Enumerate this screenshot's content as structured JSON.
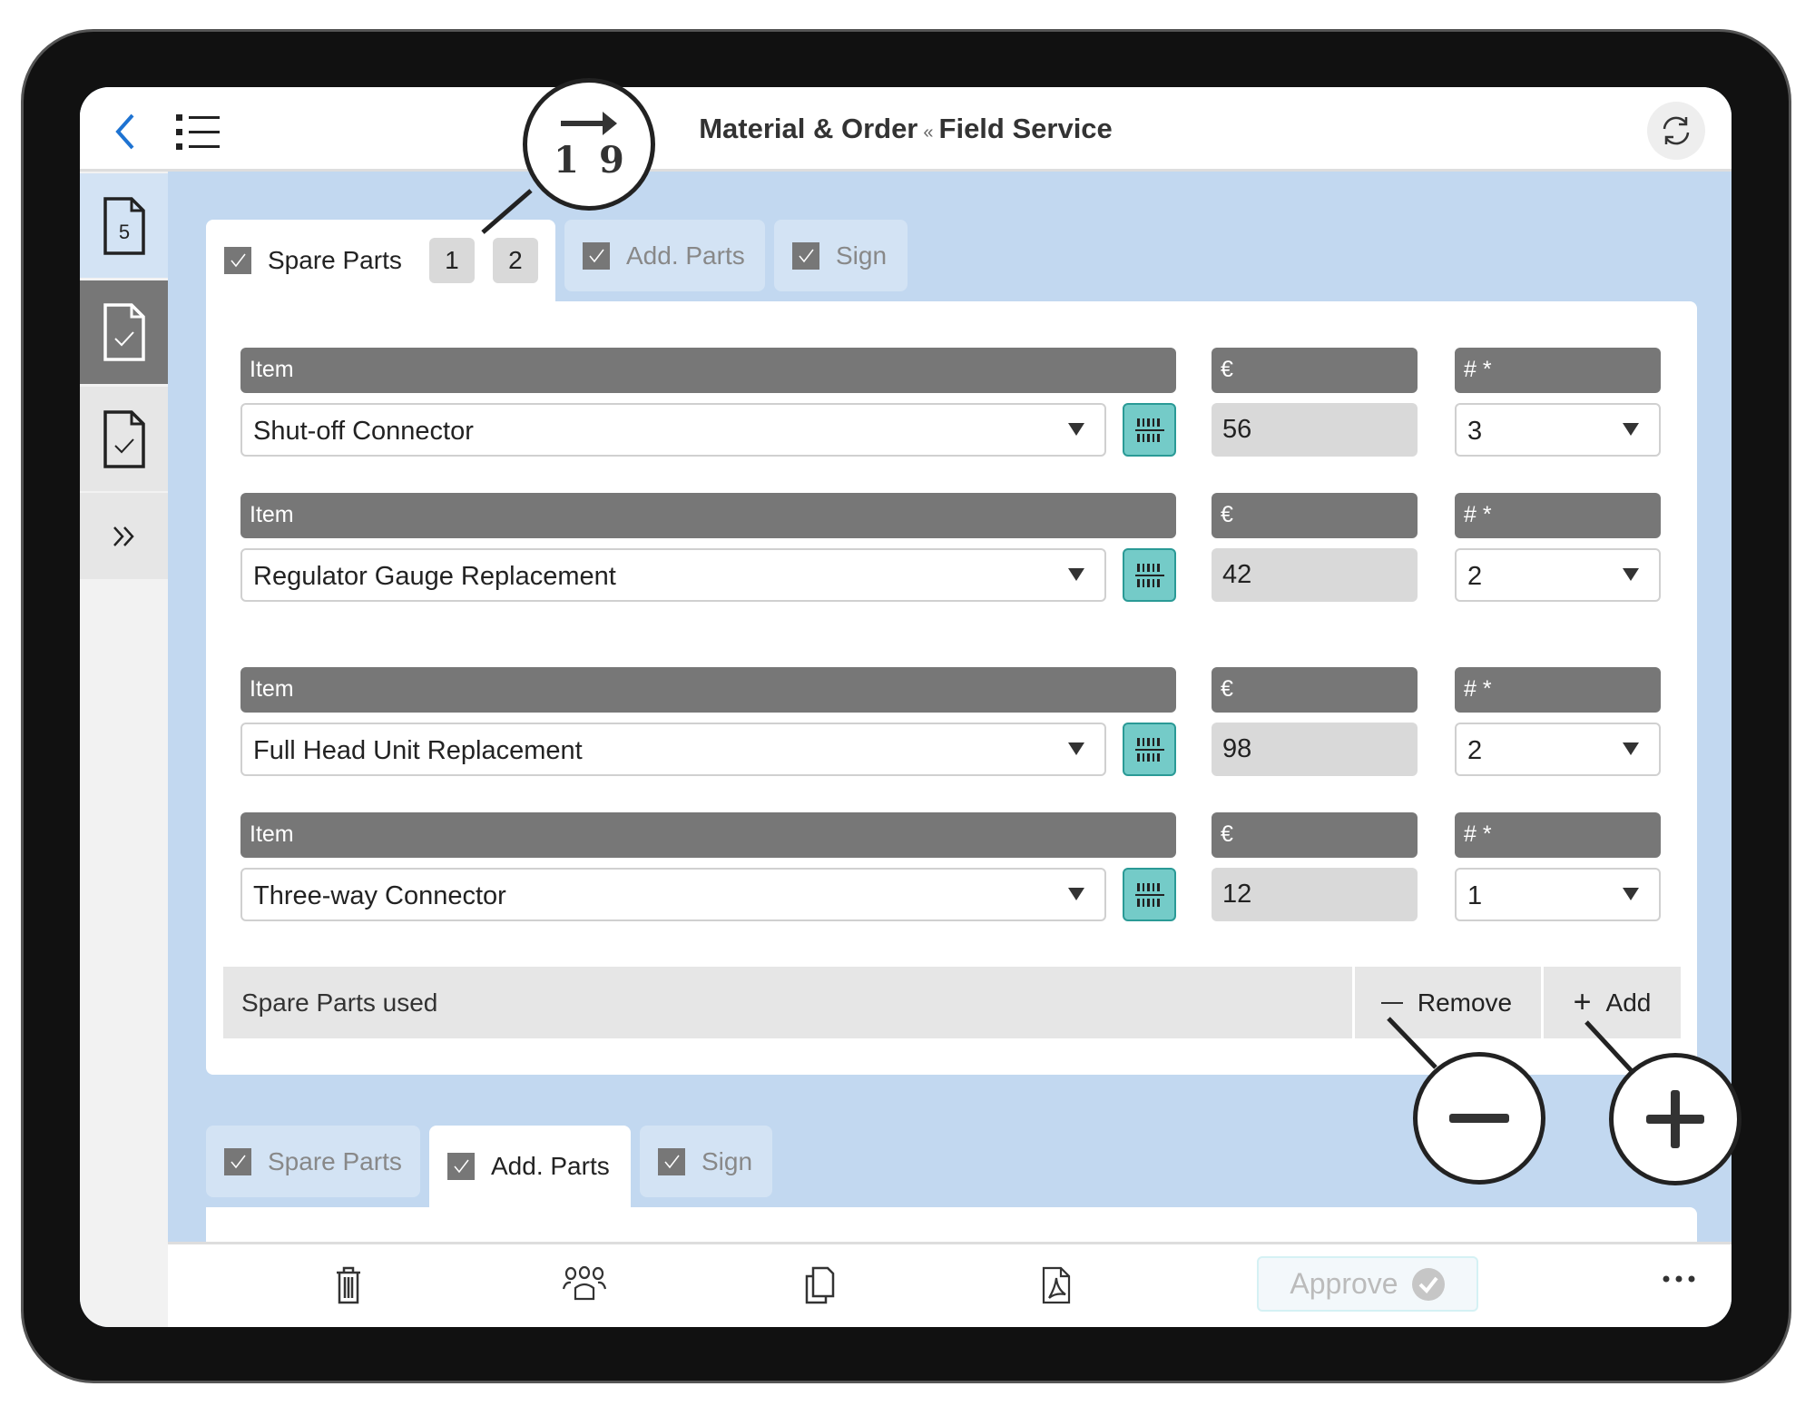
{
  "header": {
    "title_part1": "Material & Order",
    "separator": "«",
    "title_part2": "Field Service"
  },
  "sidebar": {
    "items": [
      {
        "icon": "document-number-icon",
        "badge": "5"
      },
      {
        "icon": "document-check-icon"
      },
      {
        "icon": "document-check-icon"
      },
      {
        "icon": "double-chevron-right-icon"
      }
    ]
  },
  "tabs_top": [
    {
      "label": "Spare Parts",
      "checked": true,
      "active": true,
      "pages": [
        "1",
        "2"
      ]
    },
    {
      "label": "Add. Parts",
      "checked": true,
      "active": false
    },
    {
      "label": "Sign",
      "checked": true,
      "active": false
    }
  ],
  "rows": [
    {
      "item_label": "Item",
      "price_label": "€",
      "qty_label": "# *",
      "item": "Shut-off Connector",
      "price": "56",
      "qty": "3"
    },
    {
      "item_label": "Item",
      "price_label": "€",
      "qty_label": "# *",
      "item": "Regulator Gauge Replacement",
      "price": "42",
      "qty": "2"
    },
    {
      "item_label": "Item",
      "price_label": "€",
      "qty_label": "# *",
      "item": "Full Head Unit Replacement",
      "price": "98",
      "qty": "2"
    },
    {
      "item_label": "Item",
      "price_label": "€",
      "qty_label": "# *",
      "item": "Three-way Connector",
      "price": "12",
      "qty": "1"
    }
  ],
  "footer": {
    "label": "Spare Parts used",
    "remove": "Remove",
    "add": "Add"
  },
  "callouts": {
    "page_jump": {
      "from": "1",
      "to": "9"
    }
  },
  "tabs_bottom": [
    {
      "label": "Spare Parts",
      "checked": true,
      "active": false
    },
    {
      "label": "Add. Parts",
      "checked": true,
      "active": true
    },
    {
      "label": "Sign",
      "checked": true,
      "active": false
    }
  ],
  "toolbar": {
    "approve": "Approve",
    "icons": [
      "trash-icon",
      "users-icon",
      "copy-icon",
      "pdf-icon",
      "more-icon"
    ]
  },
  "colors": {
    "accent_blue": "#1e73d2",
    "background": "#c2d8f0",
    "header_bar": "#777777",
    "barcode": "#74cbc8"
  }
}
